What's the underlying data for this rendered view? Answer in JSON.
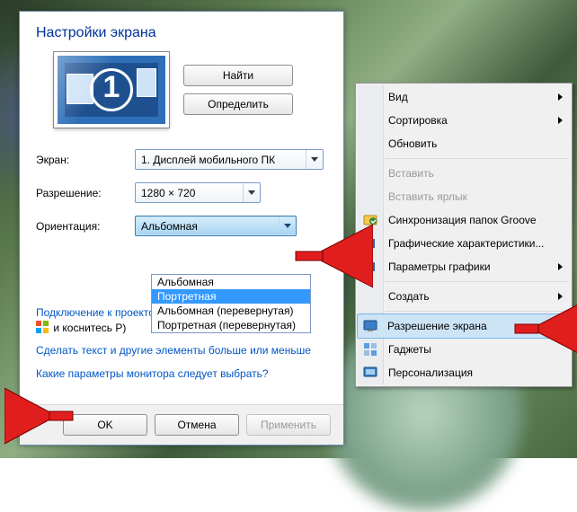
{
  "settings": {
    "title": "Настройки экрана",
    "find": "Найти",
    "detect": "Определить",
    "labels": {
      "display": "Экран:",
      "resolution": "Разрешение:",
      "orientation": "Ориентация:"
    },
    "display_value": "1. Дисплей мобильного ПК",
    "resolution_value": "1280 × 720",
    "orientation_value": "Альбомная",
    "orientation_options": [
      "Альбомная",
      "Портретная",
      "Альбомная (перевернутая)",
      "Портретная (перевернутая)"
    ],
    "link_projector": "Подключение к проектору (или нажмите клавишу",
    "link_projector_tail": "и коснитесь P)",
    "link_textsize": "Сделать текст и другие элементы больше или меньше",
    "link_help": "Какие параметры монитора следует выбрать?",
    "ok": "OK",
    "cancel": "Отмена",
    "apply": "Применить"
  },
  "ctx": {
    "view": "Вид",
    "sort": "Сортировка",
    "refresh": "Обновить",
    "paste": "Вставить",
    "paste_shortcut": "Вставить ярлык",
    "groove": "Синхронизация папок Groove",
    "gfx_props": "Графические характеристики...",
    "gfx_params": "Параметры графики",
    "new": "Создать",
    "resolution": "Разрешение экрана",
    "gadgets": "Гаджеты",
    "personalize": "Персонализация"
  }
}
